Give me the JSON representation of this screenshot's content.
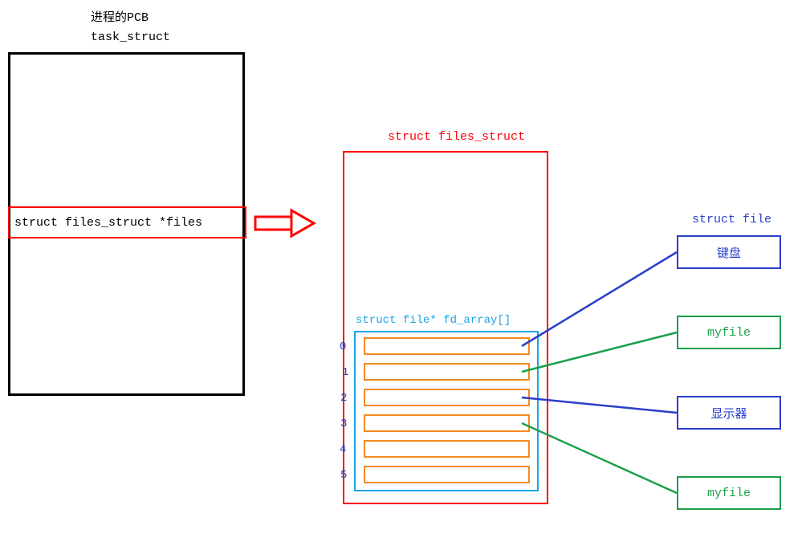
{
  "titles": {
    "pcb": "进程的PCB",
    "task_struct": "task_struct",
    "files_ptr": "struct files_struct *files",
    "files_struct": "struct files_struct",
    "fd_array": "struct file* fd_array[]",
    "struct_file": "struct file"
  },
  "fd_indices": [
    "0",
    "1",
    "2",
    "3",
    "4",
    "5"
  ],
  "struct_files": {
    "keyboard": "键盘",
    "myfile1": "myfile",
    "display": "显示器",
    "myfile2": "myfile"
  },
  "colors": {
    "black": "#000000",
    "red": "#ff0000",
    "blue": "#2a3fc9",
    "cyan": "#1ba5e8",
    "orange": "#f38b1e",
    "green": "#1ca04a"
  }
}
